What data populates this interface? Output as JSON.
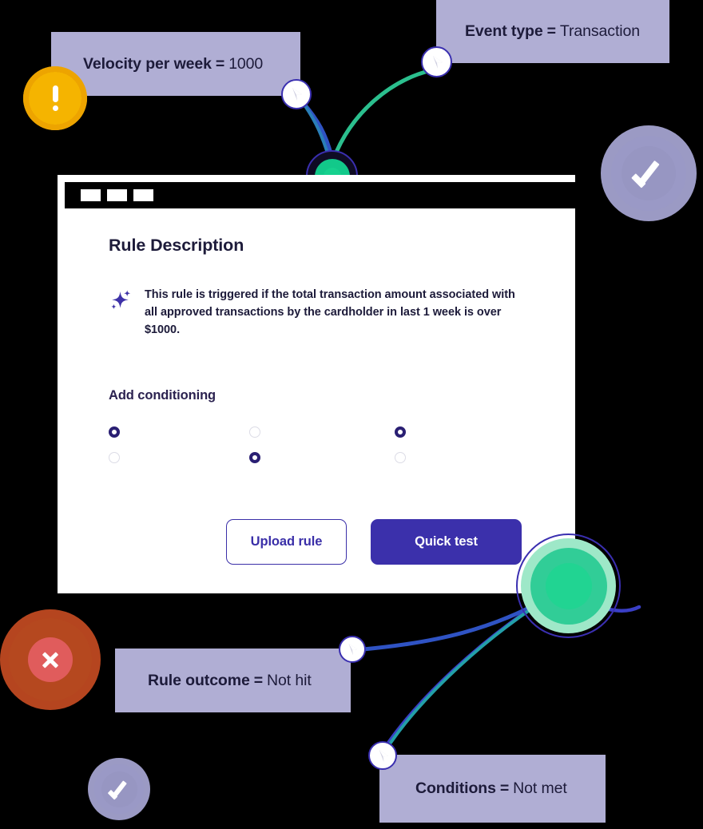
{
  "page": {
    "background_color": "#000000",
    "accent_color": "#3b30ab",
    "chip_color": "#b0aed4",
    "node_green": "#21d492",
    "warning_color": "#f5b400",
    "error_color": "#b5481f",
    "check_color": "#9b9ac4"
  },
  "chips": [
    {
      "id": "velocity",
      "key": "Velocity per week",
      "eq": "=",
      "value": "1000"
    },
    {
      "id": "event_type",
      "key": "Event type",
      "eq": "=",
      "value": "Transaction"
    },
    {
      "id": "rule_outcome",
      "key": "Rule outcome",
      "eq": "=",
      "value": "Not hit"
    },
    {
      "id": "conditions",
      "key": "Conditions",
      "eq": "=",
      "value": "Not met"
    }
  ],
  "badges": [
    {
      "id": "warning",
      "icon": "exclamation-icon",
      "color": "#f5b400"
    },
    {
      "id": "error",
      "icon": "x-circle-icon",
      "color": "#b5481f"
    },
    {
      "id": "check_large",
      "icon": "check-icon",
      "color": "#9b9ac4"
    },
    {
      "id": "check_small",
      "icon": "check-icon",
      "color": "#9b9ac4"
    }
  ],
  "card": {
    "titlebar": {
      "controls": [
        "",
        "",
        ""
      ]
    },
    "title": "Rule Description",
    "description_icon": "sparkle-icon",
    "description": "This rule is triggered if the total transaction amount associated with all approved transactions by the cardholder in last 1 week is over $1000.",
    "conditioning": {
      "title": "Add conditioning",
      "radios": [
        {
          "row": 1,
          "col": 1,
          "selected": true
        },
        {
          "row": 1,
          "col": 2,
          "selected": false
        },
        {
          "row": 1,
          "col": 3,
          "selected": true
        },
        {
          "row": 2,
          "col": 1,
          "selected": false
        },
        {
          "row": 2,
          "col": 2,
          "selected": true
        },
        {
          "row": 2,
          "col": 3,
          "selected": false
        }
      ]
    },
    "actions": {
      "upload_label": "Upload rule",
      "quick_test_label": "Quick test"
    }
  },
  "graph": {
    "nodes": [
      {
        "id": "puck-top-left",
        "icon": "cursor-node-icon"
      },
      {
        "id": "puck-top-right",
        "icon": "cursor-node-icon"
      },
      {
        "id": "puck-mid-left",
        "icon": "cursor-node-icon"
      },
      {
        "id": "puck-bottom-left",
        "icon": "cursor-node-icon"
      },
      {
        "id": "green-node-top",
        "icon": "green-node-icon"
      },
      {
        "id": "green-node-bottom",
        "icon": "green-node-icon"
      }
    ],
    "edge_colors": {
      "blue": "#3a46c8",
      "green": "#2bbf8e",
      "teal": "#1f8fb0"
    }
  }
}
